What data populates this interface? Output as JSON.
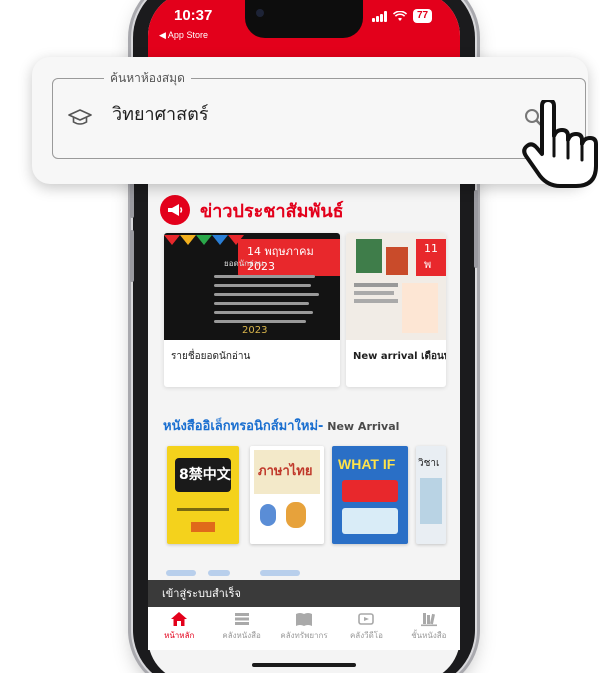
{
  "status_bar": {
    "time": "10:37",
    "back_label": "◀ App Store",
    "battery": "77"
  },
  "search": {
    "legend": "ค้นหาห้องสมุด",
    "value": "วิทยาศาสตร์"
  },
  "news": {
    "title": "ข่าวประชาสัมพันธ์",
    "cards": [
      {
        "date_badge": "14 พฤษภาคม 2023",
        "board_heading": "ยอดนักอ่าน",
        "board_year": "2023",
        "caption": "รายชื่อยอดนักอ่าน"
      },
      {
        "date_badge": "11 พ",
        "caption": "New arrival เดือนพ"
      }
    ]
  },
  "new_arrival": {
    "title_th": "หนังสืออิเล็กทรอนิกส์มาใหม่-",
    "title_en": " New Arrival",
    "books": [
      {
        "cover_text": "8禁中文"
      },
      {
        "cover_text": "ภาษาไทย"
      },
      {
        "cover_text": "WHAT IF"
      },
      {
        "cover_text": "วิชาเ"
      }
    ]
  },
  "toast": "เข้าสู่ระบบสำเร็จ",
  "tabs": [
    {
      "label": "หน้าหลัก",
      "icon": "home-icon",
      "active": true
    },
    {
      "label": "คลังหนังสือ",
      "icon": "books-icon",
      "active": false
    },
    {
      "label": "คลังทรัพยากร",
      "icon": "open-book-icon",
      "active": false
    },
    {
      "label": "คลังวีดีโอ",
      "icon": "video-icon",
      "active": false
    },
    {
      "label": "ชั้นหนังสือ",
      "icon": "bookshelf-icon",
      "active": false
    }
  ],
  "colors": {
    "brand_red": "#e3001b",
    "link_blue": "#1a6fd0"
  }
}
